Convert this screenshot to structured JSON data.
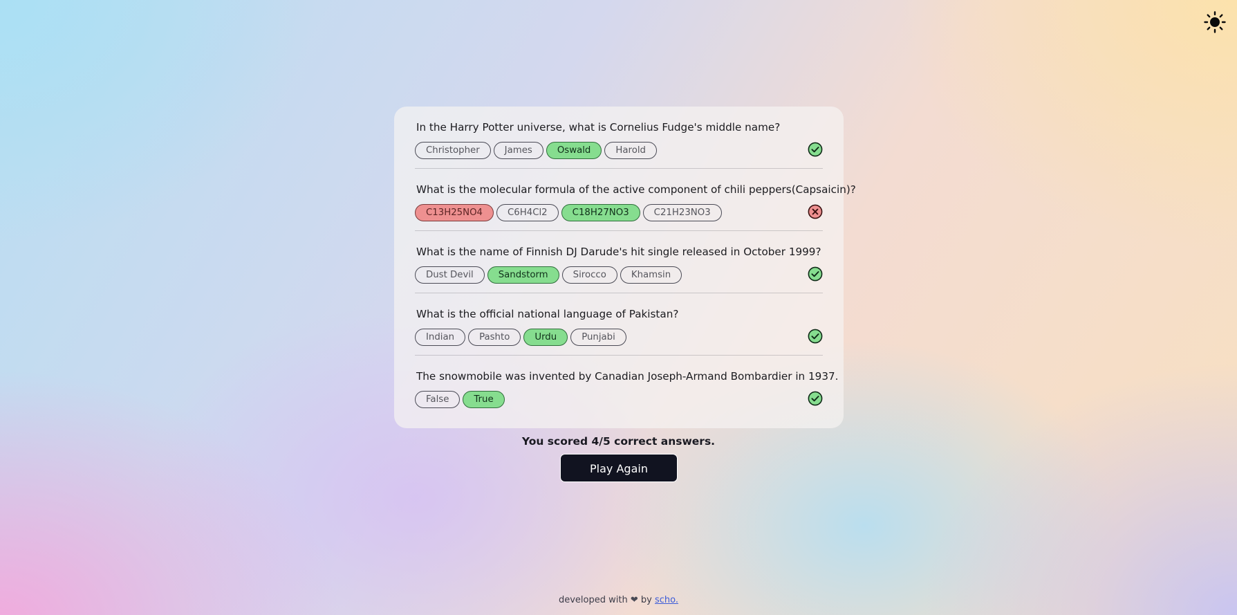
{
  "theme_toggle": {
    "icon": "sun-icon"
  },
  "colors": {
    "correct": "#86dd8f",
    "wrong": "#ee9090",
    "button_bg": "#111320"
  },
  "questions": [
    {
      "text": "In the Harry Potter universe, what is Cornelius Fudge's middle name?",
      "answers": [
        {
          "label": "Christopher",
          "state": "neutral"
        },
        {
          "label": "James",
          "state": "neutral"
        },
        {
          "label": "Oswald",
          "state": "correct"
        },
        {
          "label": "Harold",
          "state": "neutral"
        }
      ],
      "result": "correct"
    },
    {
      "text": "What is the molecular formula of the active component of chili peppers(Capsaicin)?",
      "answers": [
        {
          "label": "C13H25NO4",
          "state": "wrong"
        },
        {
          "label": "C6H4Cl2",
          "state": "neutral"
        },
        {
          "label": "C18H27NO3",
          "state": "correct"
        },
        {
          "label": "C21H23NO3",
          "state": "neutral"
        }
      ],
      "result": "wrong"
    },
    {
      "text": "What is the name of Finnish DJ Darude's hit single released in October 1999?",
      "answers": [
        {
          "label": "Dust Devil",
          "state": "neutral"
        },
        {
          "label": "Sandstorm",
          "state": "correct"
        },
        {
          "label": "Sirocco",
          "state": "neutral"
        },
        {
          "label": "Khamsin",
          "state": "neutral"
        }
      ],
      "result": "correct"
    },
    {
      "text": "What is the official national language of Pakistan?",
      "answers": [
        {
          "label": "Indian",
          "state": "neutral"
        },
        {
          "label": "Pashto",
          "state": "neutral"
        },
        {
          "label": "Urdu",
          "state": "correct"
        },
        {
          "label": "Punjabi",
          "state": "neutral"
        }
      ],
      "result": "correct"
    },
    {
      "text": "The snowmobile was invented by Canadian Joseph-Armand Bombardier in 1937.",
      "answers": [
        {
          "label": "False",
          "state": "neutral"
        },
        {
          "label": "True",
          "state": "correct"
        }
      ],
      "result": "correct"
    }
  ],
  "score_text": "You scored 4/5 correct answers.",
  "play_again_label": "Play Again",
  "footer": {
    "prefix": "developed with",
    "heart": "❤",
    "by": "by",
    "link_text": "scho."
  }
}
